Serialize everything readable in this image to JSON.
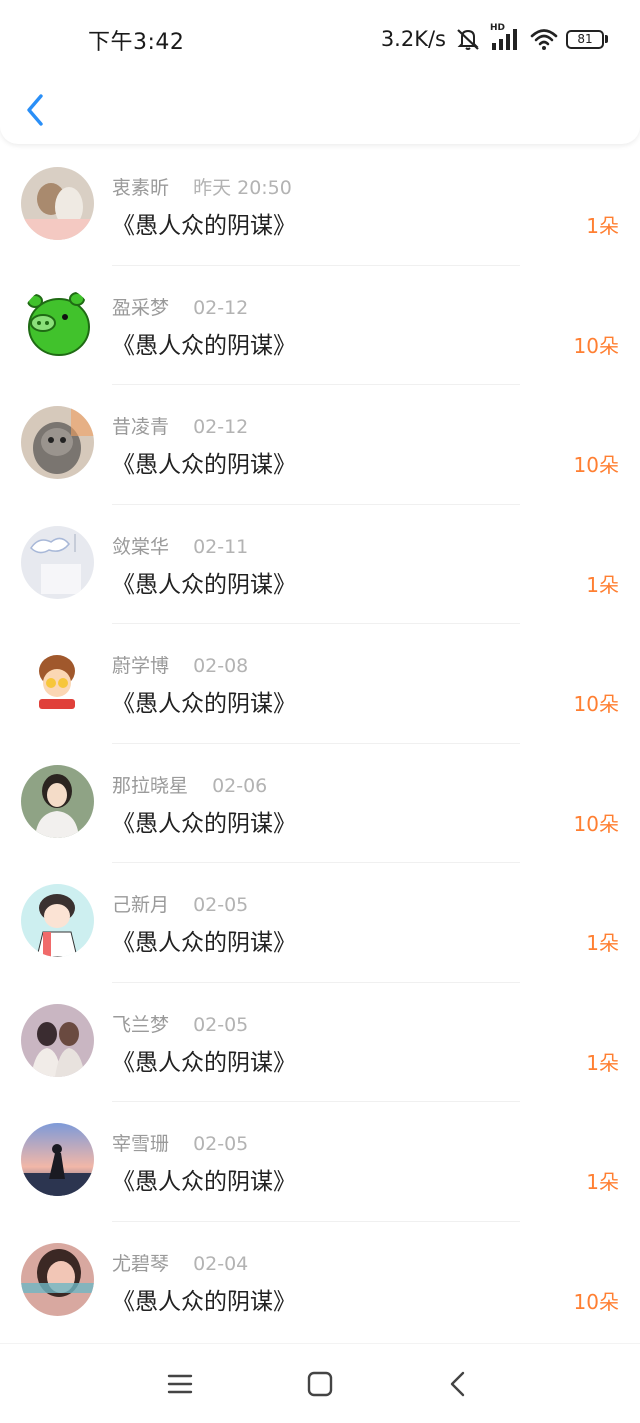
{
  "status_bar": {
    "time": "下午3:42",
    "net_speed": "3.2K/s",
    "hd_label": "HD",
    "battery": "81",
    "icons": [
      "mute-icon",
      "signal-icon",
      "wifi-icon",
      "battery-icon"
    ]
  },
  "header": {
    "back_icon": "chevron-left-icon",
    "accent_color": "#2a8ff7"
  },
  "colors": {
    "gift_count": "#ff7f32",
    "meta_text": "#9a9a9a"
  },
  "records": [
    {
      "name": "衷素昕",
      "time": "昨天 20:50",
      "book": "《愚人众的阴谋》",
      "count": "1朵"
    },
    {
      "name": "盈采梦",
      "time": "02-12",
      "book": "《愚人众的阴谋》",
      "count": "10朵"
    },
    {
      "name": "昔凌青",
      "time": "02-12",
      "book": "《愚人众的阴谋》",
      "count": "10朵"
    },
    {
      "name": "敛棠华",
      "time": "02-11",
      "book": "《愚人众的阴谋》",
      "count": "1朵"
    },
    {
      "name": "蔚学博",
      "time": "02-08",
      "book": "《愚人众的阴谋》",
      "count": "10朵"
    },
    {
      "name": "那拉晓星",
      "time": "02-06",
      "book": "《愚人众的阴谋》",
      "count": "10朵"
    },
    {
      "name": "己新月",
      "time": "02-05",
      "book": "《愚人众的阴谋》",
      "count": "1朵"
    },
    {
      "name": "飞兰梦",
      "time": "02-05",
      "book": "《愚人众的阴谋》",
      "count": "1朵"
    },
    {
      "name": "宰雪珊",
      "time": "02-05",
      "book": "《愚人众的阴谋》",
      "count": "1朵"
    },
    {
      "name": "尤碧琴",
      "time": "02-04",
      "book": "《愚人众的阴谋》",
      "count": "10朵"
    }
  ],
  "nav_bar": {
    "icons": [
      "menu-icon",
      "home-icon",
      "back-icon"
    ]
  }
}
